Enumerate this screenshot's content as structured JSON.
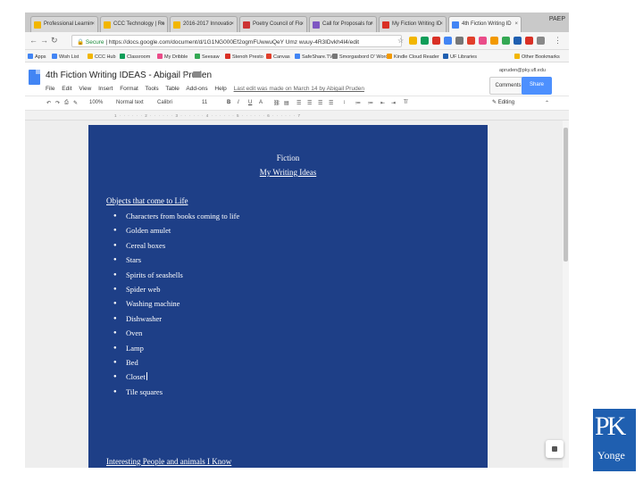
{
  "browser": {
    "tabs": [
      {
        "label": "Professional Learnin",
        "color": "#f2b600"
      },
      {
        "label": "CCC Technology | Re",
        "color": "#f2b600"
      },
      {
        "label": "2016-2017 Innovatio",
        "color": "#f2b600"
      },
      {
        "label": "Poetry Council of Flo",
        "color": "#cc3333"
      },
      {
        "label": "Call for Proposals for",
        "color": "#7e57c2"
      },
      {
        "label": "My Fiction Writing ID",
        "color": "#d93025"
      },
      {
        "label": "4th Fiction Writing ID",
        "color": "#4285f4"
      }
    ],
    "window_label": "PAEP",
    "address": {
      "secure_label": "Secure",
      "url": "https://docs.google.com/document/d/1G1NG000Ef2ogmFUwwuQeY Umz wuuy-4R3IDvkh4I4/edit"
    },
    "bookmarks": [
      {
        "label": "Apps",
        "color": "#4285f4"
      },
      {
        "label": "Wish List",
        "color": "#4285f4"
      },
      {
        "label": "CCC Hub",
        "color": "#f2b600"
      },
      {
        "label": "Classroom",
        "color": "#0f9d58"
      },
      {
        "label": "My Dribble",
        "color": "#ea4c89"
      },
      {
        "label": "Seesaw",
        "color": "#34a853"
      },
      {
        "label": "Stenoh Presto",
        "color": "#d93025"
      },
      {
        "label": "Canvas",
        "color": "#e13f2b"
      },
      {
        "label": "SafeShare.TV",
        "color": "#4285f4"
      },
      {
        "label": "Smorgasbord O' Words",
        "color": "#777777"
      },
      {
        "label": "Kindle Cloud Reader",
        "color": "#f29900"
      },
      {
        "label": "UF Libraries",
        "color": "#1f5fb0"
      },
      {
        "label": "Other Bookmarks",
        "color": "#f2b600"
      }
    ]
  },
  "docs": {
    "title": "4th Fiction Writing IDEAS - Abigail Pruden",
    "menu": [
      "File",
      "Edit",
      "View",
      "Insert",
      "Format",
      "Tools",
      "Table",
      "Add-ons",
      "Help"
    ],
    "last_edit": "Last edit was made on March 14 by Abigail Pruden",
    "user_email": "apruden@pky.ufl.edu",
    "comments_label": "Comments",
    "share_label": "Share",
    "toolbar": {
      "zoom": "100%",
      "style": "Normal text",
      "font": "Calibri",
      "size": "11",
      "editing": "Editing"
    },
    "ruler_ticks": "1 · · · · · · 2 · · · · · · 3 · · · · · · 4 · · · · · · 5 · · · · · · 6 · · · · · · 7"
  },
  "document": {
    "title": "Fiction",
    "subtitle": "My Writing Ideas",
    "section1": "Objects that come to Life",
    "items": [
      "Characters from books coming to life",
      "Golden amulet",
      "Cereal boxes",
      "Stars",
      "Spirits of seashells",
      "Spider web",
      "Washing machine",
      "Dishwasher",
      "Oven",
      "Lamp",
      "Bed",
      "Closet",
      "Tile squares"
    ],
    "section2": "Interesting People and animals I Know"
  },
  "logo": {
    "letters": "PK",
    "word": "Yonge"
  }
}
